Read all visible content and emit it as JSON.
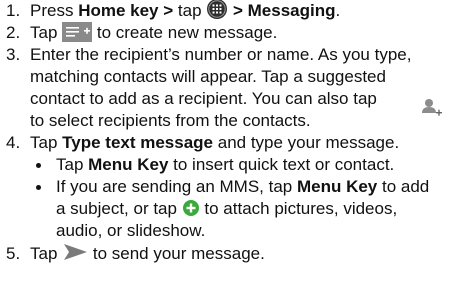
{
  "steps": [
    {
      "number": "1.",
      "t1": "Press ",
      "t2": "Home key > ",
      "t3": "tap ",
      "t4": " > Messaging",
      "t5": ".",
      "icon": "apps-grid-icon"
    },
    {
      "number": "2.",
      "t1": "Tap ",
      "t2": " to create new message.",
      "icon": "new-message-icon"
    },
    {
      "number": "3.",
      "l1": "Enter the recipient’s number or name. As you type,",
      "l2": "matching contacts will appear. Tap a suggested",
      "l3a": "contact to add as a recipient. You can also tap",
      "l4": "to select recipients from the contacts.",
      "icon": "add-contact-icon"
    },
    {
      "number": "4.",
      "t1": "Tap ",
      "t2": "Type text message",
      "t3": " and type your message.",
      "bullets": [
        {
          "a": "Tap ",
          "b": "Menu Key",
          "c": " to insert quick text or contact."
        },
        {
          "a": "If you are sending an MMS, tap ",
          "b": "Menu Key",
          "c": " to add",
          "l2a": "a subject, or tap ",
          "l2b": " to attach pictures, videos,",
          "l3": "audio, or slideshow.",
          "icon": "attach-plus-icon"
        }
      ]
    },
    {
      "number": "5.",
      "t1": "Tap ",
      "t2": " to send your message.",
      "icon": "send-icon"
    }
  ]
}
